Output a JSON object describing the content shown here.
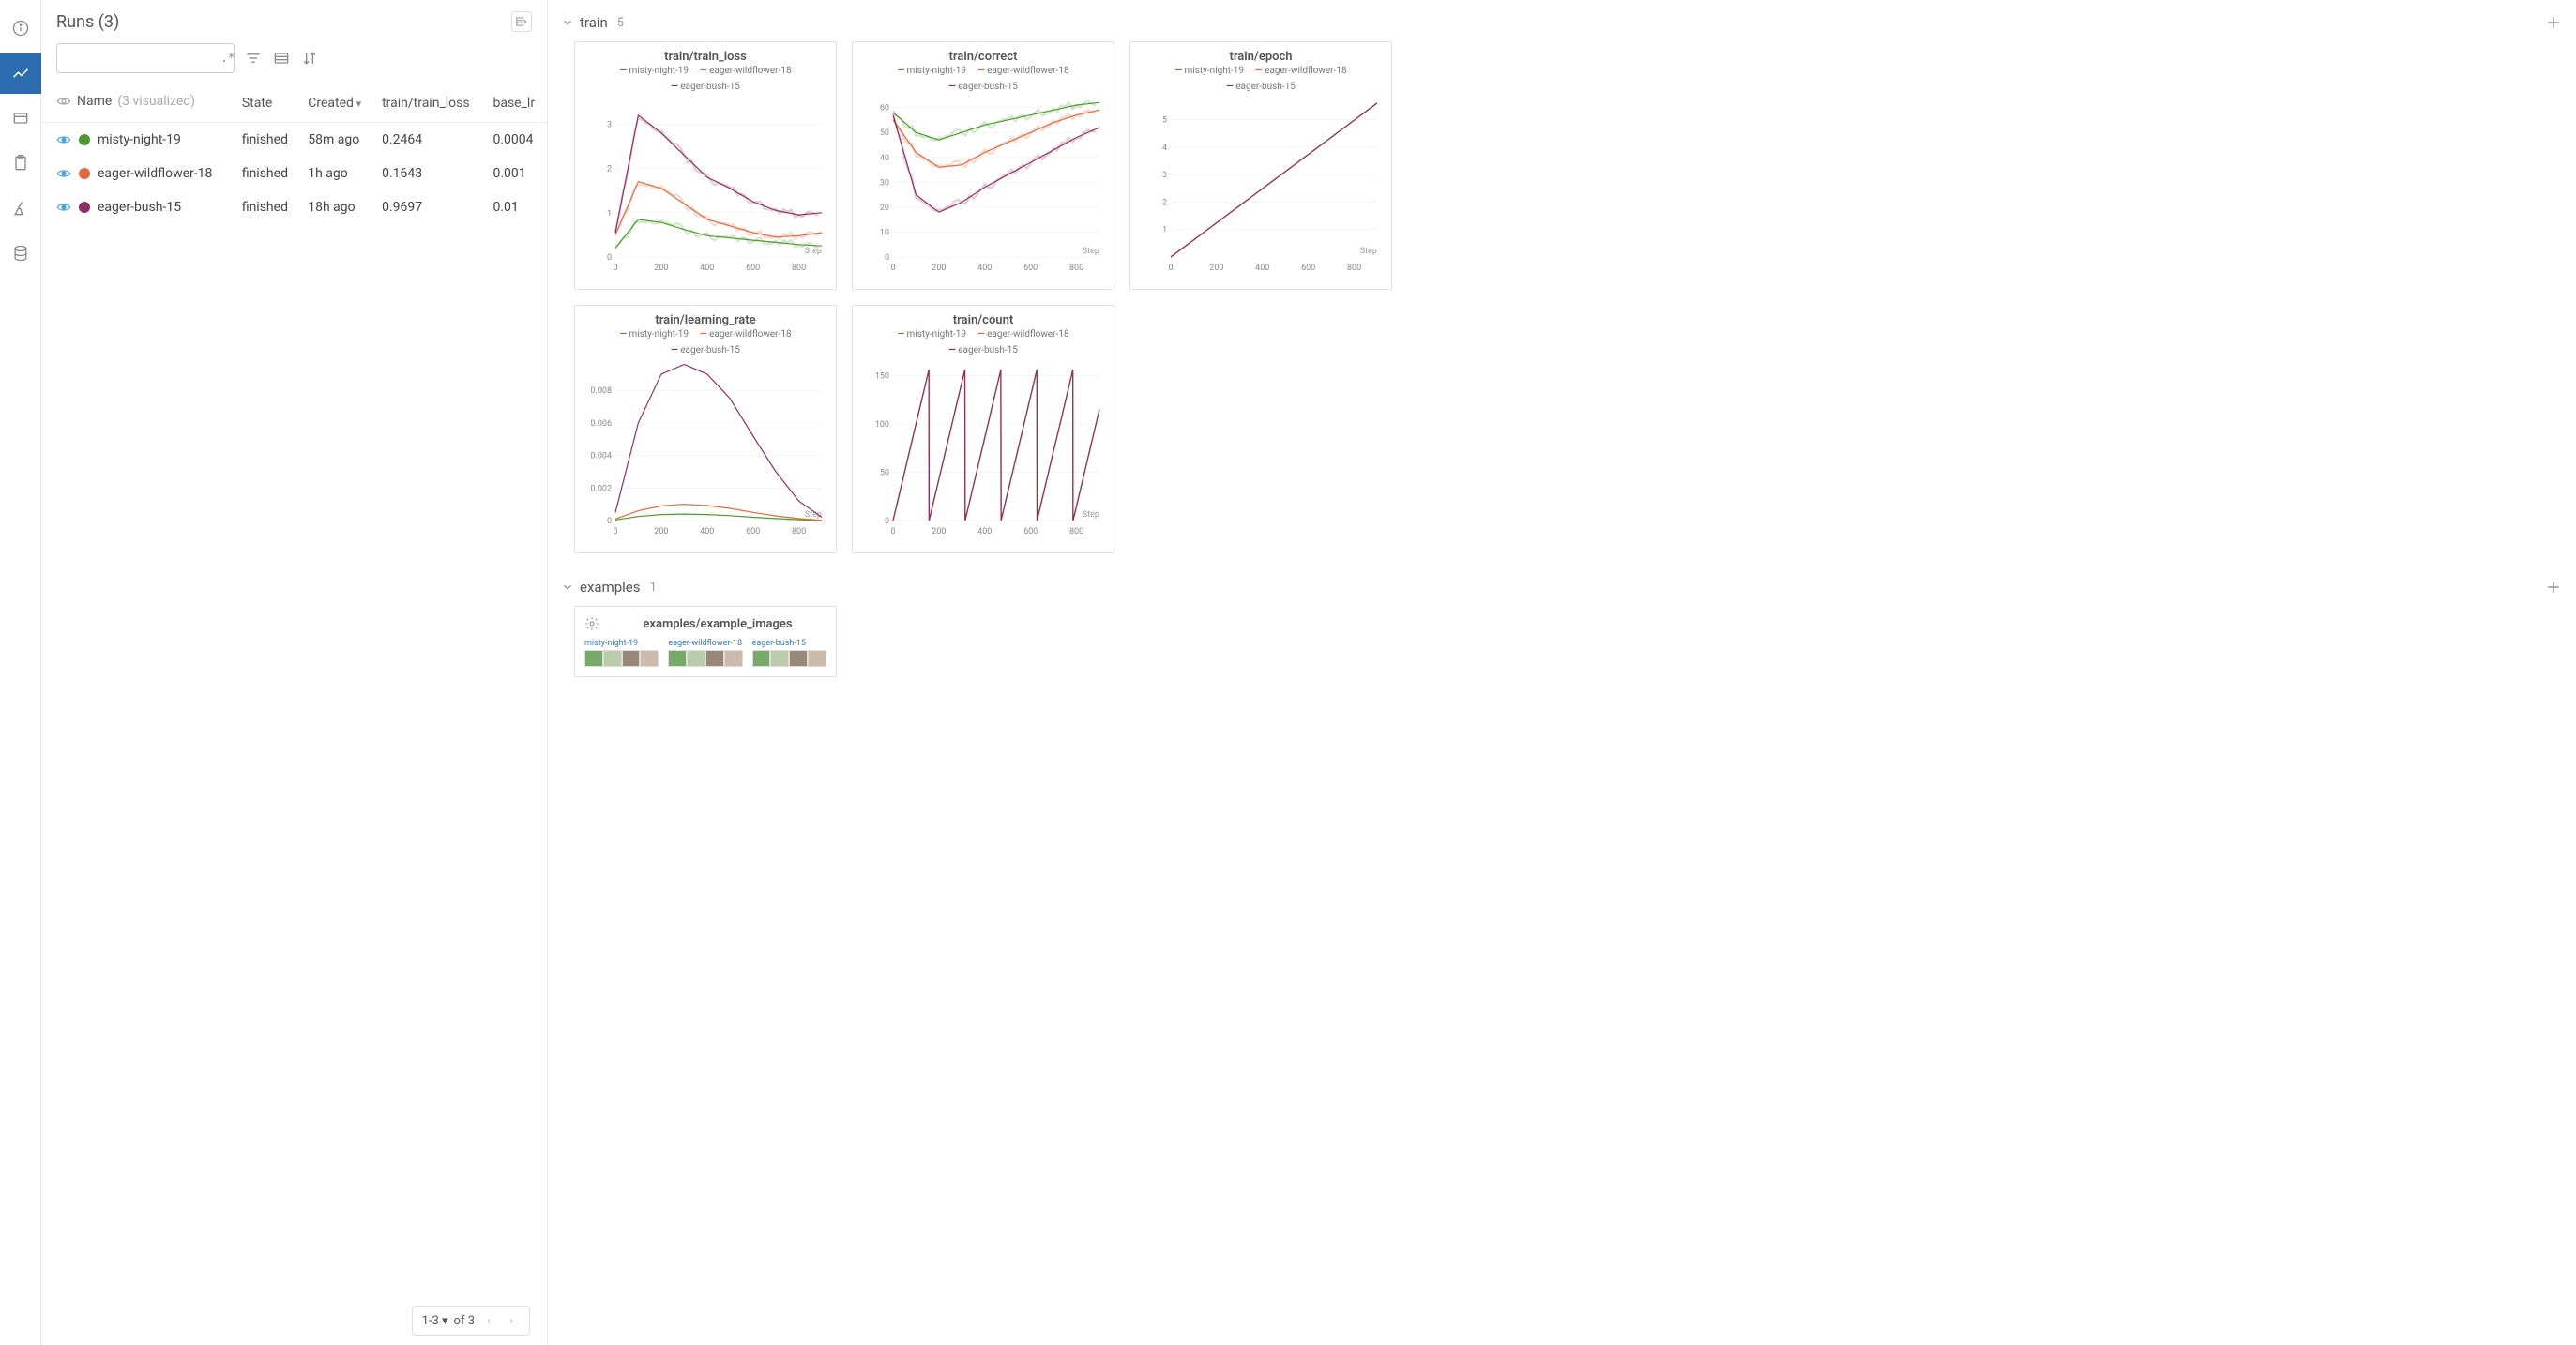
{
  "runs_panel": {
    "title": "Runs (3)",
    "search_placeholder": "",
    "regex_hint": ".*",
    "columns": {
      "name": "Name",
      "name_sub": "(3 visualized)",
      "state": "State",
      "created": "Created",
      "metric": "train/train_loss",
      "lr": "base_lr"
    },
    "rows": [
      {
        "color": "#4c9a2a",
        "name": "misty-night-19",
        "state": "finished",
        "created": "58m ago",
        "metric": "0.2464",
        "lr": "0.0004"
      },
      {
        "color": "#e06a3b",
        "name": "eager-wildflower-18",
        "state": "finished",
        "created": "1h ago",
        "metric": "0.1643",
        "lr": "0.001"
      },
      {
        "color": "#8e2f63",
        "name": "eager-bush-15",
        "state": "finished",
        "created": "18h ago",
        "metric": "0.9697",
        "lr": "0.01"
      }
    ],
    "pager": {
      "range": "1-3",
      "of_label": "of 3"
    }
  },
  "sections": {
    "train": {
      "title": "train",
      "count": "5"
    },
    "examples": {
      "title": "examples",
      "count": "1"
    }
  },
  "legend_names": [
    "misty-night-19",
    "eager-wildflower-18",
    "eager-bush-15"
  ],
  "panels": {
    "train_loss": {
      "title": "train/train_loss"
    },
    "correct": {
      "title": "train/correct"
    },
    "epoch": {
      "title": "train/epoch"
    },
    "learning_rate": {
      "title": "train/learning_rate"
    },
    "count": {
      "title": "train/count"
    },
    "examples": {
      "title": "examples/example_images"
    }
  },
  "axis": {
    "x_label": "Step"
  },
  "chart_data": [
    {
      "id": "train_loss",
      "type": "line",
      "title": "train/train_loss",
      "xlabel": "Step",
      "ylabel": "",
      "x": [
        0,
        100,
        200,
        300,
        400,
        500,
        600,
        700,
        800,
        900
      ],
      "x_ticks": [
        0,
        200,
        400,
        600,
        800
      ],
      "y_ticks": [
        0,
        1,
        2,
        3
      ],
      "ylim": [
        0,
        3.6
      ],
      "xlim": [
        0,
        900
      ],
      "series": [
        {
          "name": "misty-night-19",
          "color": "#4c9a2a",
          "values": [
            0.2,
            0.85,
            0.78,
            0.62,
            0.48,
            0.43,
            0.38,
            0.33,
            0.28,
            0.25
          ]
        },
        {
          "name": "eager-wildflower-18",
          "color": "#e06a3b",
          "values": [
            0.5,
            1.7,
            1.55,
            1.2,
            0.85,
            0.7,
            0.55,
            0.45,
            0.48,
            0.55
          ]
        },
        {
          "name": "eager-bush-15",
          "color": "#8e2f63",
          "values": [
            0.55,
            3.2,
            2.8,
            2.3,
            1.8,
            1.55,
            1.25,
            1.05,
            0.95,
            1.0
          ]
        }
      ],
      "noise": 0.18
    },
    {
      "id": "correct",
      "type": "line",
      "title": "train/correct",
      "xlabel": "Step",
      "ylabel": "",
      "x": [
        0,
        100,
        200,
        300,
        400,
        500,
        600,
        700,
        800,
        900
      ],
      "x_ticks": [
        0,
        200,
        400,
        600,
        800
      ],
      "y_ticks": [
        0,
        10,
        20,
        30,
        40,
        50,
        60
      ],
      "ylim": [
        0,
        64
      ],
      "xlim": [
        0,
        900
      ],
      "series": [
        {
          "name": "misty-night-19",
          "color": "#4c9a2a",
          "values": [
            58,
            50,
            47,
            50,
            53,
            55,
            57,
            59,
            61,
            62
          ]
        },
        {
          "name": "eager-wildflower-18",
          "color": "#e06a3b",
          "values": [
            55,
            42,
            36,
            37,
            42,
            46,
            50,
            54,
            57,
            59
          ]
        },
        {
          "name": "eager-bush-15",
          "color": "#8e2f63",
          "values": [
            57,
            25,
            18,
            22,
            28,
            33,
            38,
            43,
            48,
            52
          ]
        }
      ],
      "noise": 3.5
    },
    {
      "id": "epoch",
      "type": "line",
      "title": "train/epoch",
      "xlabel": "Step",
      "ylabel": "",
      "x": [
        0,
        900
      ],
      "x_ticks": [
        0,
        200,
        400,
        600,
        800
      ],
      "y_ticks": [
        1,
        2,
        3,
        4,
        5
      ],
      "ylim": [
        0,
        5.8
      ],
      "xlim": [
        0,
        900
      ],
      "series": [
        {
          "name": "misty-night-19",
          "color": "#4c9a2a",
          "values": [
            0,
            5.6
          ]
        },
        {
          "name": "eager-wildflower-18",
          "color": "#e06a3b",
          "values": [
            0,
            5.6
          ]
        },
        {
          "name": "eager-bush-15",
          "color": "#8e2f63",
          "values": [
            0,
            5.6
          ]
        }
      ],
      "noise": 0
    },
    {
      "id": "learning_rate",
      "type": "line",
      "title": "train/learning_rate",
      "xlabel": "Step",
      "ylabel": "",
      "x": [
        0,
        100,
        200,
        300,
        400,
        500,
        600,
        700,
        800,
        900
      ],
      "x_ticks": [
        0,
        200,
        400,
        600,
        800
      ],
      "y_ticks": [
        0,
        0.002,
        0.004,
        0.006,
        0.008
      ],
      "ylim": [
        0,
        0.0098
      ],
      "xlim": [
        0,
        900
      ],
      "series": [
        {
          "name": "misty-night-19",
          "color": "#4c9a2a",
          "values": [
            4e-05,
            0.00025,
            0.00037,
            0.0004,
            0.00037,
            0.0003,
            0.0002,
            0.00012,
            5e-05,
            1e-05
          ]
        },
        {
          "name": "eager-wildflower-18",
          "color": "#e06a3b",
          "values": [
            0.0001,
            0.0006,
            0.0009,
            0.001,
            0.00092,
            0.00075,
            0.0005,
            0.00028,
            0.00012,
            2e-05
          ]
        },
        {
          "name": "eager-bush-15",
          "color": "#8e2f63",
          "values": [
            0.0005,
            0.006,
            0.009,
            0.0096,
            0.009,
            0.0075,
            0.0052,
            0.003,
            0.0012,
            0.0002
          ]
        }
      ],
      "noise": 0
    },
    {
      "id": "count",
      "type": "line",
      "title": "train/count",
      "xlabel": "Step",
      "ylabel": "",
      "x": [
        0,
        25,
        50,
        75,
        100,
        125,
        150,
        156,
        157,
        182,
        207,
        232,
        257,
        282,
        307,
        313,
        314,
        339,
        364,
        389,
        414,
        439,
        464,
        470,
        471,
        496,
        521,
        546,
        571,
        596,
        621,
        627,
        628,
        653,
        678,
        703,
        728,
        753,
        778,
        784,
        785,
        810,
        835,
        860,
        885,
        900
      ],
      "x_ticks": [
        0,
        200,
        400,
        600,
        800
      ],
      "y_ticks": [
        0,
        50,
        100,
        150
      ],
      "ylim": [
        0,
        165
      ],
      "xlim": [
        0,
        900
      ],
      "series": [
        {
          "name": "misty-night-19",
          "color": "#4c9a2a",
          "values": [
            0,
            25,
            50,
            75,
            100,
            125,
            150,
            156,
            0,
            25,
            50,
            75,
            100,
            125,
            150,
            156,
            0,
            25,
            50,
            75,
            100,
            125,
            150,
            156,
            0,
            25,
            50,
            75,
            100,
            125,
            150,
            156,
            0,
            25,
            50,
            75,
            100,
            125,
            150,
            156,
            0,
            25,
            50,
            75,
            100,
            115
          ]
        },
        {
          "name": "eager-wildflower-18",
          "color": "#e06a3b",
          "values": [
            0,
            25,
            50,
            75,
            100,
            125,
            150,
            156,
            0,
            25,
            50,
            75,
            100,
            125,
            150,
            156,
            0,
            25,
            50,
            75,
            100,
            125,
            150,
            156,
            0,
            25,
            50,
            75,
            100,
            125,
            150,
            156,
            0,
            25,
            50,
            75,
            100,
            125,
            150,
            156,
            0,
            25,
            50,
            75,
            100,
            115
          ]
        },
        {
          "name": "eager-bush-15",
          "color": "#8e2f63",
          "values": [
            0,
            25,
            50,
            75,
            100,
            125,
            150,
            156,
            0,
            25,
            50,
            75,
            100,
            125,
            150,
            156,
            0,
            25,
            50,
            75,
            100,
            125,
            150,
            156,
            0,
            25,
            50,
            75,
            100,
            125,
            150,
            156,
            0,
            25,
            50,
            75,
            100,
            125,
            150,
            156,
            0,
            25,
            50,
            75,
            100,
            115
          ]
        }
      ],
      "noise": 0
    }
  ]
}
